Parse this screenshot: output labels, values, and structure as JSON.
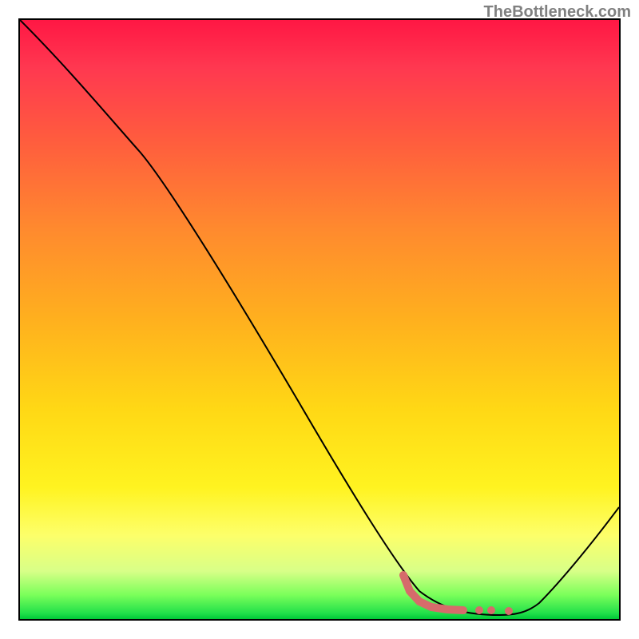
{
  "watermark": "TheBottleneck.com",
  "chart_data": {
    "type": "line",
    "title": "",
    "xlabel": "",
    "ylabel": "",
    "xlim": [
      0,
      100
    ],
    "ylim": [
      0,
      100
    ],
    "series": [
      {
        "name": "curve",
        "color": "#000000",
        "x": [
          0,
          20,
          40,
          60,
          73,
          78,
          85,
          100
        ],
        "y": [
          100,
          80,
          45,
          15,
          3,
          1,
          0.5,
          18
        ]
      },
      {
        "name": "highlight",
        "color": "#d66b6b",
        "x": [
          64,
          67,
          70,
          72,
          74,
          76,
          78,
          80,
          82,
          84
        ],
        "y": [
          6,
          4,
          2.5,
          2,
          1.5,
          1.3,
          1.2,
          1.2,
          1.2,
          1.2
        ]
      }
    ],
    "gradient": {
      "top_color": "#ff1744",
      "middle_color": "#ffd815",
      "bottom_color": "#00c838"
    }
  }
}
